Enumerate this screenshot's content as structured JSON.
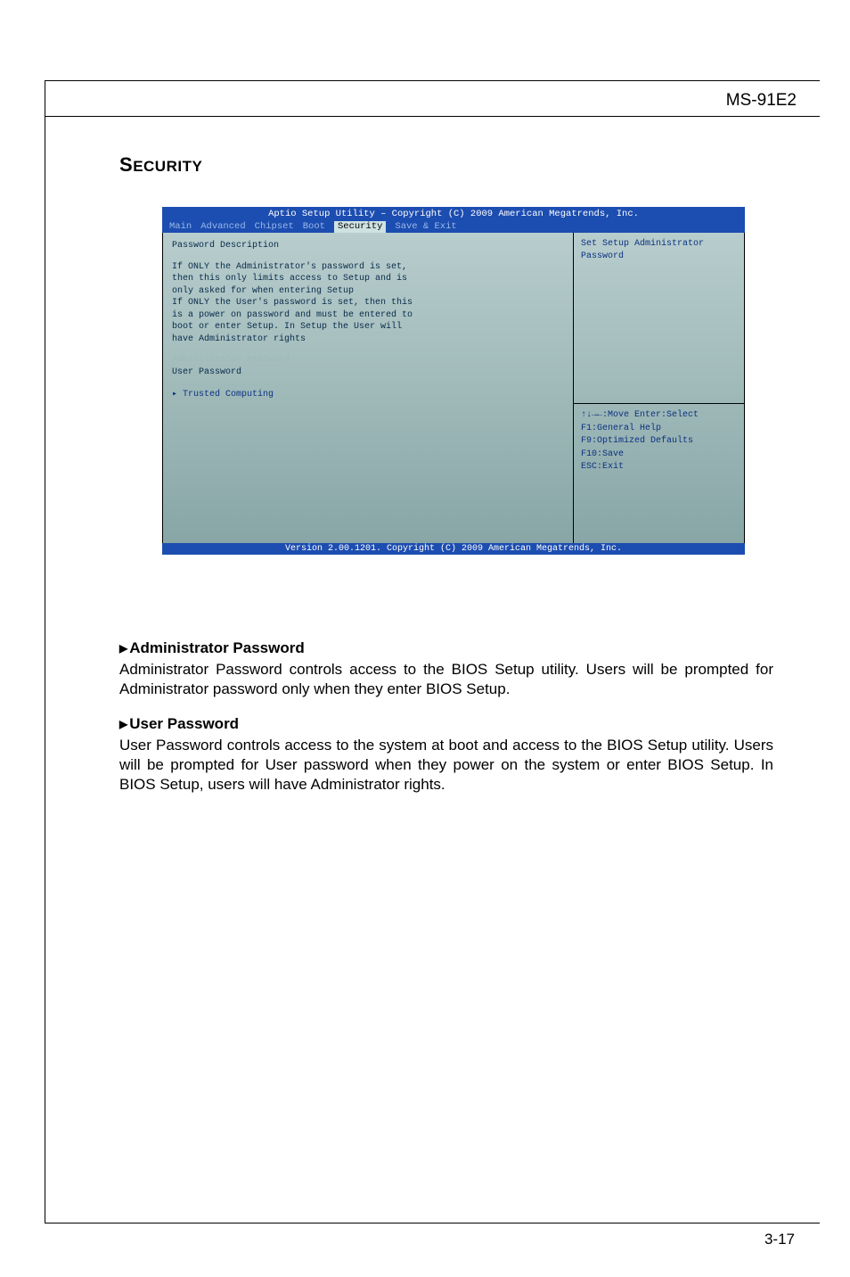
{
  "header": {
    "model": "MS-91E2"
  },
  "section_title": "Security",
  "bios": {
    "top_title": "Aptio Setup Utility – Copyright (C) 2009 American Megatrends, Inc.",
    "tabs": [
      "Main",
      "Advanced",
      "Chipset",
      "Boot",
      "Security",
      "Save & Exit"
    ],
    "active_tab": "Security",
    "left": {
      "heading": "Password Description",
      "desc_lines": [
        "If ONLY the Administrator's password is set,",
        "then this only limits access to Setup and is",
        "only asked for when entering Setup",
        "If ONLY the User's password is set, then this",
        "is a power on password and must be entered to",
        "boot or enter Setup. In Setup the User will",
        "have Administrator rights"
      ],
      "admin_item": "Administrator Password",
      "user_item": "User Password",
      "trusted_item": "▸ Trusted Computing"
    },
    "right": {
      "help_top": "Set Setup Administrator Password",
      "hints": [
        "↑↓→←:Move  Enter:Select",
        "F1:General Help",
        "F9:Optimized Defaults",
        "F10:Save",
        "ESC:Exit"
      ]
    },
    "footer": "Version 2.00.1201. Copyright (C) 2009 American Megatrends, Inc."
  },
  "doc": {
    "sec1_title": "Administrator Password",
    "sec1_text": "Administrator Password controls access to the BIOS Setup utility. Users will be prompted for Administrator password only when they enter BIOS Setup.",
    "sec2_title": "User Password",
    "sec2_text": "User Password controls access to the system at boot and access to the BIOS Setup utility. Users will be prompted for User password when they power on the system or enter BIOS Setup. In BIOS Setup, users will have Administrator rights."
  },
  "page_number": "3-17"
}
